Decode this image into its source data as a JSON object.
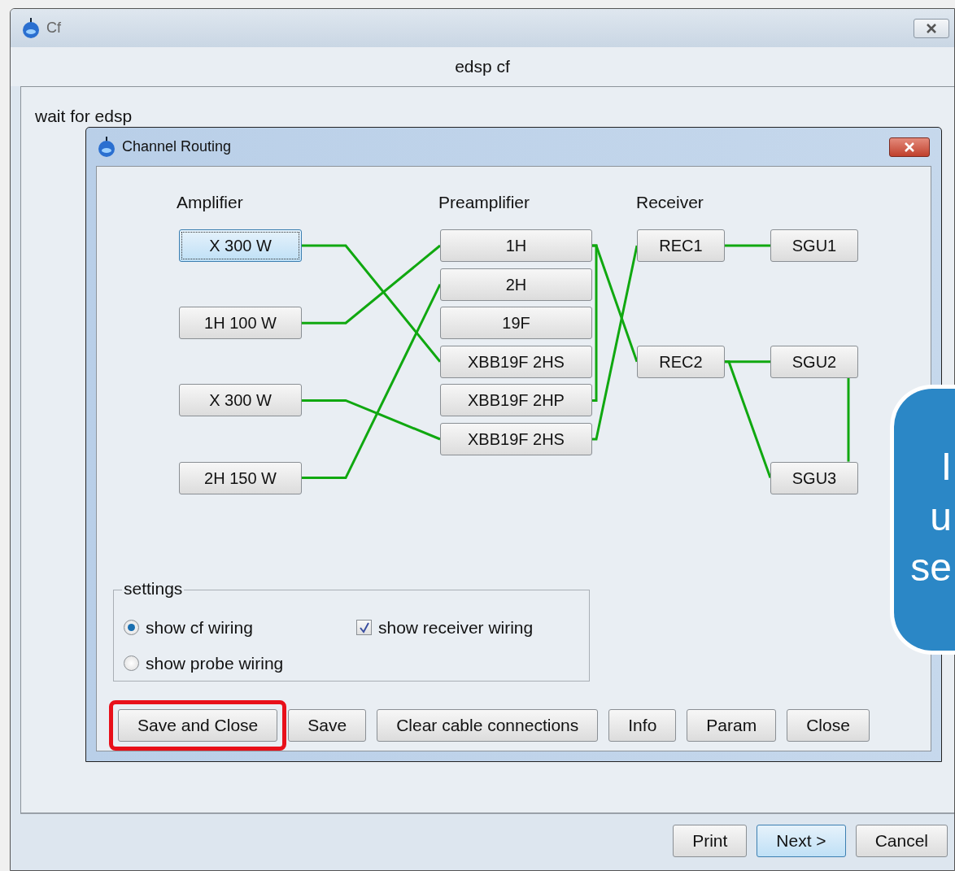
{
  "window": {
    "title": "Cf",
    "header": "edsp cf",
    "status": "wait for edsp"
  },
  "dialog": {
    "title": "Channel Routing",
    "column_labels": [
      "Amplifier",
      "Preamplifier",
      "Receiver"
    ],
    "amplifiers": [
      {
        "label": "X 300 W",
        "selected": true
      },
      {
        "label": "1H 100 W",
        "selected": false
      },
      {
        "label": "X 300 W",
        "selected": false
      },
      {
        "label": "2H 150 W",
        "selected": false
      }
    ],
    "preamplifiers": [
      {
        "label": "1H"
      },
      {
        "label": "2H"
      },
      {
        "label": "19F"
      },
      {
        "label": "XBB19F 2HS"
      },
      {
        "label": "XBB19F 2HP"
      },
      {
        "label": "XBB19F 2HS"
      }
    ],
    "receivers": [
      {
        "label": "REC1"
      },
      {
        "label": "REC2"
      }
    ],
    "sgus": [
      {
        "label": "SGU1"
      },
      {
        "label": "SGU2"
      },
      {
        "label": "SGU3"
      }
    ],
    "settings": {
      "title": "settings",
      "options": [
        {
          "kind": "radio",
          "label": "show cf wiring",
          "checked": true
        },
        {
          "kind": "checkbox",
          "label": "show receiver wiring",
          "checked": true
        },
        {
          "kind": "radio",
          "label": "show probe wiring",
          "checked": false
        }
      ]
    },
    "buttons": [
      {
        "label": "Save and Close",
        "highlighted": true
      },
      {
        "label": "Save",
        "highlighted": false
      },
      {
        "label": "Clear cable connections",
        "highlighted": false
      },
      {
        "label": "Info",
        "highlighted": false
      },
      {
        "label": "Param",
        "highlighted": false
      },
      {
        "label": "Close",
        "highlighted": false
      }
    ]
  },
  "footer_buttons": [
    {
      "label": "Print",
      "default": false
    },
    {
      "label": "Next >",
      "default": true
    },
    {
      "label": "Cancel",
      "default": false
    }
  ],
  "callout": {
    "lines": [
      "I",
      "u",
      "se"
    ]
  }
}
